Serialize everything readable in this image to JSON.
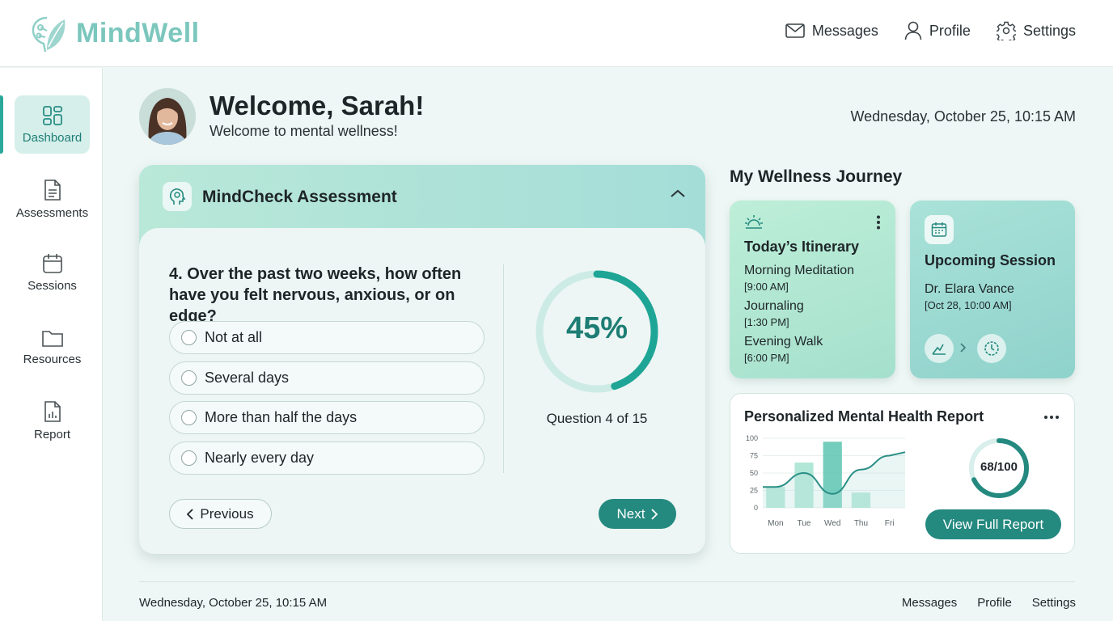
{
  "app": {
    "brand": "MindWell"
  },
  "topnav": {
    "messages": "Messages",
    "profile": "Profile",
    "settings": "Settings"
  },
  "sidebar": {
    "items": [
      {
        "label": "Dashboard",
        "icon": "dashboard-icon",
        "active": true
      },
      {
        "label": "Assessments",
        "icon": "document-icon"
      },
      {
        "label": "Sessions",
        "icon": "calendar-icon"
      },
      {
        "label": "Resources",
        "icon": "folder-icon"
      },
      {
        "label": "Report",
        "icon": "report-icon"
      }
    ]
  },
  "header": {
    "welcome": "Welcome, Sarah!",
    "subtitle": "Welcome to mental wellness!",
    "datetime": "Wednesday, October 25, 10:15 AM"
  },
  "assessment": {
    "title": "MindCheck Assessment",
    "question": "4. Over the past two weeks, how often have you felt nervous, anxious, or on edge?",
    "options": [
      "Not at all",
      "Several days",
      "More than half the days",
      "Nearly every day"
    ],
    "progress_percent": 45,
    "progress_text": "45%",
    "progress_label": "Question 4 of 15",
    "prev_label": "Previous",
    "next_label": "Next"
  },
  "journey": {
    "title": "My Wellness Journey",
    "itinerary": {
      "title": "Today’s Itinerary",
      "items": [
        {
          "name": "Morning Meditation",
          "time": "[9:00 AM]"
        },
        {
          "name": "Journaling",
          "time": "[1:30 PM]"
        },
        {
          "name": "Evening Walk",
          "time": "[6:00 PM]"
        }
      ]
    },
    "session": {
      "title": "Upcoming Session",
      "doctor": "Dr. Elara Vance",
      "time": "[Oct 28, 10:00 AM]"
    }
  },
  "report": {
    "title": "Personalized Mental Health Report",
    "score_text": "68/100",
    "score_value": 68,
    "button_label": "View Full Report"
  },
  "chart_data": {
    "type": "bar",
    "categories": [
      "Mon",
      "Tue",
      "Wed",
      "Thu",
      "Fri"
    ],
    "values": [
      30,
      65,
      95,
      22,
      0
    ],
    "line_values": [
      30,
      50,
      20,
      55,
      75
    ],
    "yticks": [
      0,
      25,
      50,
      75,
      100
    ],
    "ylim": [
      0,
      100
    ],
    "colors": {
      "bar": "#a3e3cf",
      "bar_highlight": "#5cc4b2",
      "line": "#2a8f86"
    }
  },
  "footer": {
    "datetime": "Wednesday, October 25, 10:15 AM",
    "links": [
      "Messages",
      "Profile",
      "Settings"
    ]
  },
  "colors": {
    "accent": "#24897f",
    "brand": "#7cc7bd",
    "background": "#eef7f5"
  }
}
